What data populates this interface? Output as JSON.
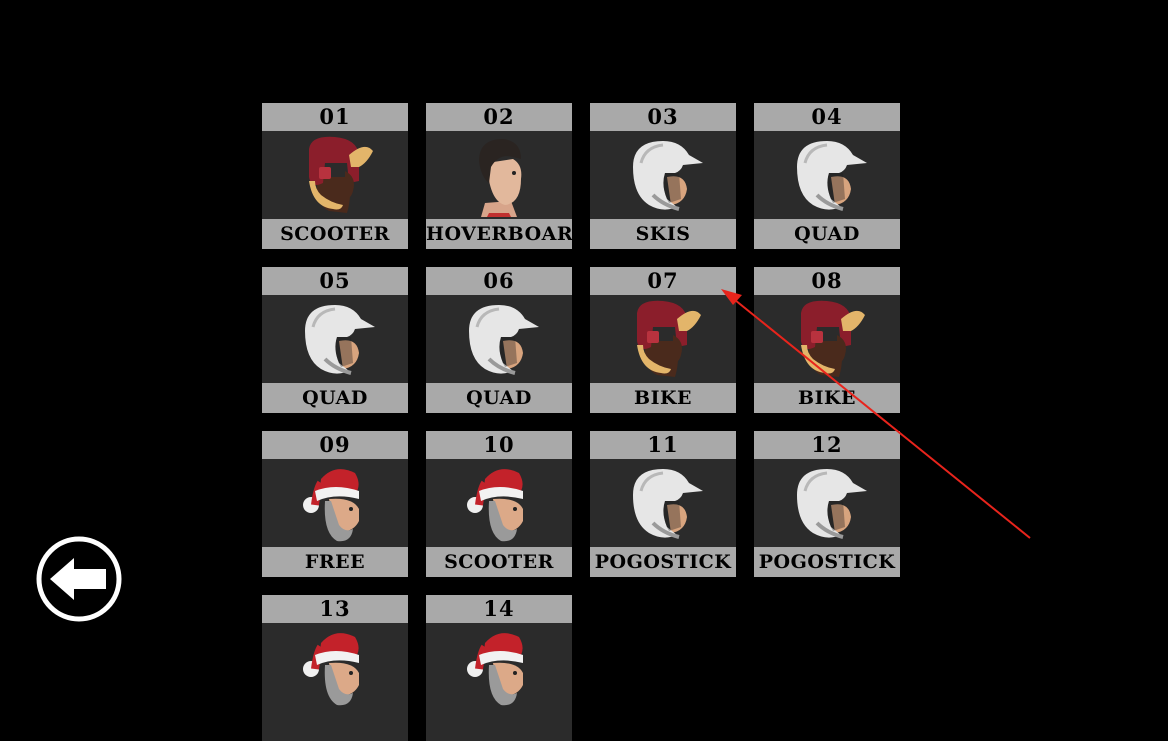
{
  "back_icon": "left-arrow-circle-icon",
  "annotation_color": "#e8241c",
  "levels": [
    {
      "num": "01",
      "vehicle": "SCOOTER",
      "rider": "trapper-hat-rider"
    },
    {
      "num": "02",
      "vehicle": "HOVERBOARD",
      "rider": "dark-hair-rider"
    },
    {
      "num": "03",
      "vehicle": "SKIS",
      "rider": "motocross-helmet-rider"
    },
    {
      "num": "04",
      "vehicle": "QUAD",
      "rider": "motocross-helmet-rider"
    },
    {
      "num": "05",
      "vehicle": "QUAD",
      "rider": "motocross-helmet-rider"
    },
    {
      "num": "06",
      "vehicle": "QUAD",
      "rider": "motocross-helmet-rider"
    },
    {
      "num": "07",
      "vehicle": "BIKE",
      "rider": "trapper-hat-rider"
    },
    {
      "num": "08",
      "vehicle": "BIKE",
      "rider": "trapper-hat-rider"
    },
    {
      "num": "09",
      "vehicle": "FREE",
      "rider": "santa-rider"
    },
    {
      "num": "10",
      "vehicle": "SCOOTER",
      "rider": "santa-rider"
    },
    {
      "num": "11",
      "vehicle": "POGOSTICK",
      "rider": "motocross-helmet-rider"
    },
    {
      "num": "12",
      "vehicle": "POGOSTICK",
      "rider": "motocross-helmet-rider"
    },
    {
      "num": "13",
      "vehicle": "",
      "rider": "santa-rider"
    },
    {
      "num": "14",
      "vehicle": "",
      "rider": "santa-rider"
    }
  ]
}
